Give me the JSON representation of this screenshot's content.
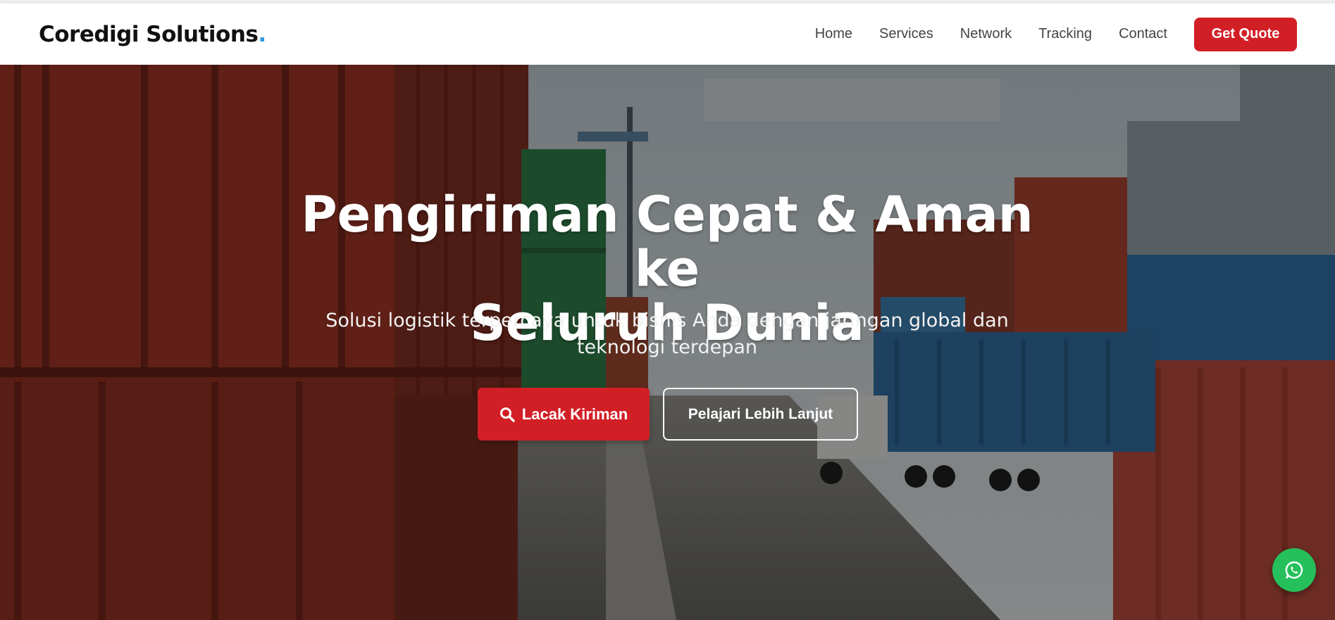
{
  "brand": {
    "name": "Coredigi Solutions",
    "dot": ".",
    "dot_color": "#2f9de0"
  },
  "nav": {
    "items": [
      {
        "label": "Home"
      },
      {
        "label": "Services"
      },
      {
        "label": "Network"
      },
      {
        "label": "Tracking"
      },
      {
        "label": "Contact"
      }
    ],
    "cta_label": "Get Quote"
  },
  "hero": {
    "title_line1": "Pengiriman Cepat & Aman ke",
    "title_line2": "Seluruh Dunia",
    "subtitle": "Solusi logistik terpercaya untuk bisnis Anda dengan jaringan global dan teknologi terdepan",
    "primary_button": {
      "label": "Lacak Kiriman",
      "icon": "search-icon"
    },
    "secondary_button": {
      "label": "Pelajari Lebih Lanjut"
    },
    "background": "container-port-photo"
  },
  "floating": {
    "icon": "whatsapp-icon"
  },
  "colors": {
    "accent": "#d21f26",
    "whatsapp": "#25c05b",
    "nav_text": "#444444",
    "brand_text": "#111111"
  }
}
